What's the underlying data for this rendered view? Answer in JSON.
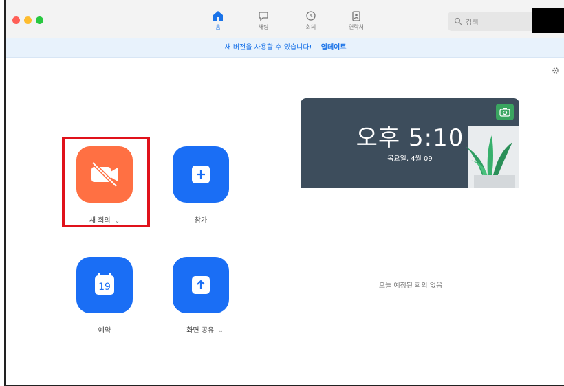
{
  "window": {
    "traffic_lights": [
      "close",
      "minimize",
      "zoom"
    ]
  },
  "nav": {
    "items": [
      {
        "label": "홈",
        "icon": "home-icon",
        "active": true
      },
      {
        "label": "채팅",
        "icon": "chat-icon",
        "active": false
      },
      {
        "label": "회의",
        "icon": "clock-icon",
        "active": false
      },
      {
        "label": "연락처",
        "icon": "contacts-icon",
        "active": false
      }
    ]
  },
  "search": {
    "placeholder": "검색"
  },
  "banner": {
    "message": "새 버전을 사용할 수 있습니다!",
    "action": "업데이트"
  },
  "actions": {
    "new_meeting": "새 회의",
    "join": "참가",
    "schedule": "예약",
    "schedule_day": "19",
    "share_screen": "화면 공유"
  },
  "clock": {
    "time": "오후 5:10",
    "date": "목요일, 4월 09"
  },
  "meetings": {
    "empty_text": "오늘 예정된 회의 없음"
  },
  "colors": {
    "accent": "#1a6ef5",
    "new_meeting": "#ff7043",
    "highlight": "#e0121b",
    "banner_bg": "#e8f2fc"
  }
}
